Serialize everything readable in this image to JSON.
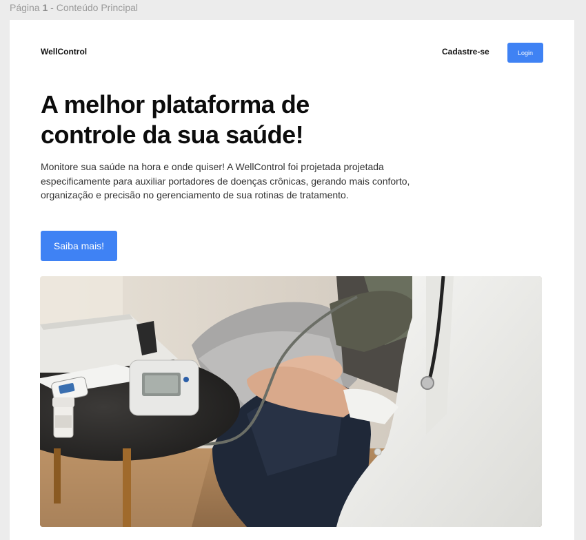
{
  "frame_label": {
    "prefix": "Página",
    "number": "1",
    "suffix": " - Conteúdo Principal"
  },
  "nav": {
    "brand": "WellControl",
    "signup": "Cadastre-se",
    "login": "Login"
  },
  "hero": {
    "title": "A melhor plataforma de controle da sua saúde!",
    "description": "Monitore sua saúde na hora e onde quiser! A WellControl foi projetada projetada especificamente para auxiliar portadores de doenças crônicas, gerando mais conforto, organização e precisão no gerenciamento de sua rotinas de tratamento.",
    "cta": "Saiba mais!"
  },
  "colors": {
    "accent": "#3f82f4",
    "text": "#0c0c0c",
    "muted": "#333333"
  }
}
